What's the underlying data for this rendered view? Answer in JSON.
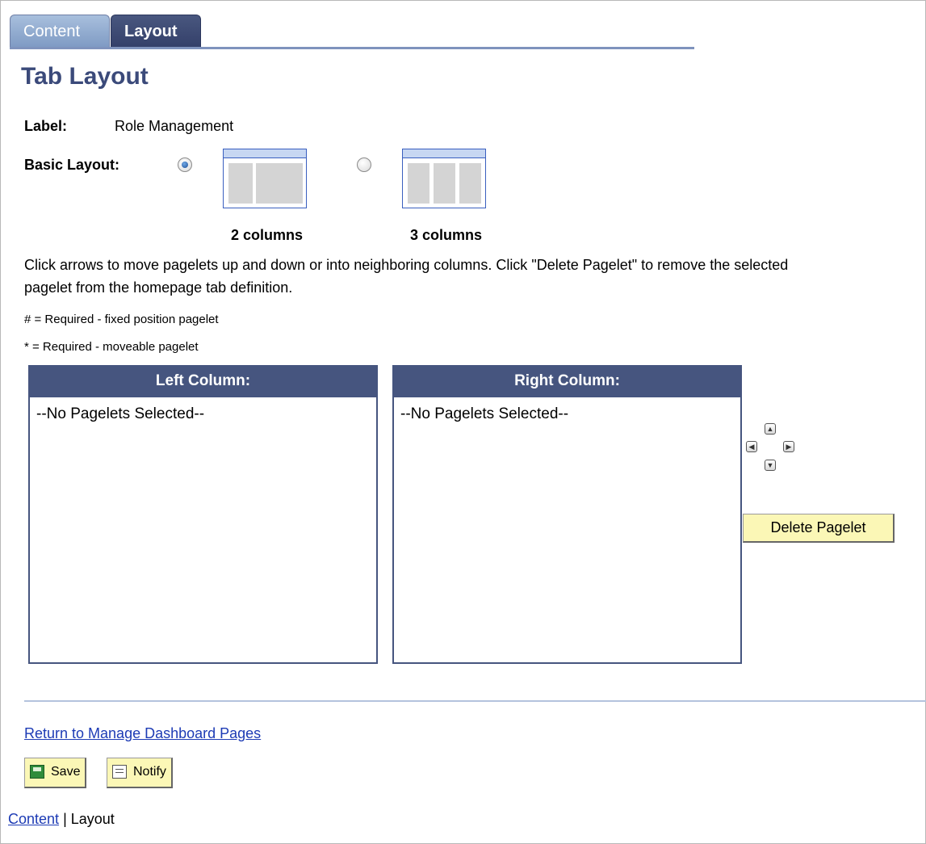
{
  "tabs": [
    {
      "label": "Content",
      "active": false
    },
    {
      "label": "Layout",
      "active": true
    }
  ],
  "page_title": "Tab Layout",
  "label_field": {
    "label": "Label:",
    "value": "Role Management"
  },
  "basic_layout": {
    "label": "Basic Layout:",
    "options": [
      {
        "caption": "2 columns",
        "selected": true
      },
      {
        "caption": "3 columns",
        "selected": false
      }
    ]
  },
  "instructions": "Click arrows to move pagelets up and down or into neighboring columns. Click \"Delete Pagelet\" to remove the selected pagelet from the homepage tab definition.",
  "legend": {
    "fixed": "# = Required - fixed position pagelet",
    "moveable": "* = Required - moveable pagelet"
  },
  "columns": [
    {
      "header": "Left Column:",
      "items": [
        "--No Pagelets Selected--"
      ]
    },
    {
      "header": "Right Column:",
      "items": [
        "--No Pagelets Selected--"
      ]
    }
  ],
  "arrows": [
    "up-arrow-icon",
    "left-arrow-icon",
    "right-arrow-icon",
    "down-arrow-icon"
  ],
  "delete_button": "Delete Pagelet",
  "return_link": "Return to Manage Dashboard Pages",
  "buttons": {
    "save": "Save",
    "notify": "Notify"
  },
  "footer_nav": {
    "content": "Content",
    "separator": "|",
    "layout": "Layout"
  },
  "colors": {
    "header_bg": "#46557f",
    "button_bg": "#fbf7b6",
    "title": "#3b4a7a",
    "link": "#1d3bb5"
  }
}
